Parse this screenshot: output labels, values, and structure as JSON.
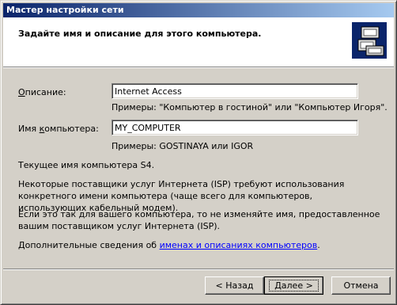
{
  "window": {
    "title": "Мастер настройки сети"
  },
  "header": {
    "title": "Задайте имя и описание для этого компьютера.",
    "icon": "network-computers-icon"
  },
  "description": {
    "label_underlined": "О",
    "label_rest": "писание:",
    "value": "Internet Access",
    "hint": "Примеры: \"Компьютер в гостиной\" или \"Компьютер Игоря\"."
  },
  "computer_name": {
    "label_pre": "Имя ",
    "label_underlined": "к",
    "label_rest": "омпьютера:",
    "value": "MY_COMPUTER",
    "hint": "Примеры: GOSTINAYA или IGOR"
  },
  "current_name_text": "Текущее имя компьютера S4.",
  "isp_text": "Некоторые поставщики услуг Интернета (ISP) требуют использования конкретного имени компьютера (чаще всего для компьютеров, использующих кабельный модем).",
  "keep_name_text": "Если это так для вашего компьютера, то не изменяйте имя, предоставленное вашим поставщиком услуг Интернета (ISP).",
  "more_info": {
    "prefix": "Дополнительные сведения об ",
    "link": "именах и описаниях компьютеров",
    "suffix": "."
  },
  "buttons": {
    "back": "< Назад",
    "next": "Далее >",
    "cancel": "Отмена"
  }
}
